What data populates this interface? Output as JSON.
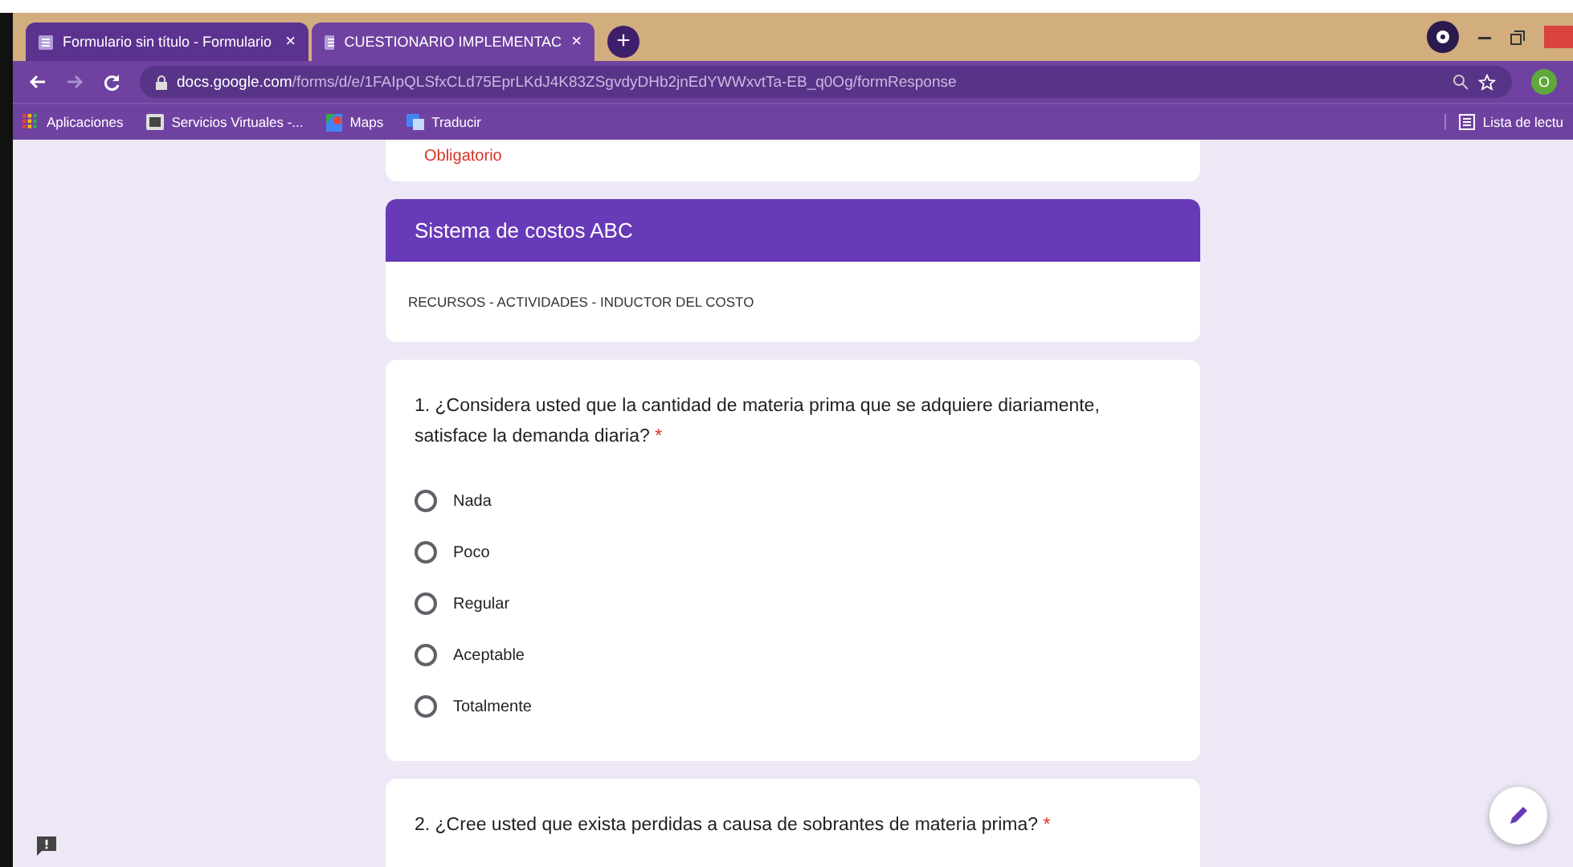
{
  "tabs": [
    {
      "label": "Formulario sin título - Formulario",
      "selected": false,
      "close": "×"
    },
    {
      "label": "CUESTIONARIO IMPLEMENTAC",
      "selected": true,
      "close": "×"
    }
  ],
  "new_tab": "+",
  "address_bar": {
    "domain": "docs.google.com",
    "path": "/forms/d/e/1FAIpQLSfxCLd75EprLKdJ4K83ZSgvdyDHb2jnEdYWWxvtTa-EB_q0Og/formResponse"
  },
  "profile_initial": "O",
  "bookmarks": [
    {
      "label": "Aplicaciones",
      "kind": "apps"
    },
    {
      "label": "Servicios Virtuales -...",
      "kind": "page"
    },
    {
      "label": "Maps",
      "kind": "maps"
    },
    {
      "label": "Traducir",
      "kind": "translate"
    }
  ],
  "reading_list": "Lista de lectu",
  "previous_card": {
    "note": "Obligatorio"
  },
  "section": {
    "title": "Sistema de costos ABC",
    "description": "RECURSOS - ACTIVIDADES - INDUCTOR DEL COSTO"
  },
  "questions": [
    {
      "text": "1. ¿Considera usted que la cantidad de materia prima que se adquiere diariamente, satisface la demanda diaria?",
      "required_mark": "*",
      "options": [
        {
          "label": "Nada",
          "selected": false
        },
        {
          "label": "Poco",
          "selected": false
        },
        {
          "label": "Regular",
          "selected": false
        },
        {
          "label": "Aceptable",
          "selected": false
        },
        {
          "label": "Totalmente",
          "selected": false
        }
      ]
    },
    {
      "text": "2. ¿Cree usted que exista perdidas a causa de sobrantes de materia prima?",
      "required_mark": "*"
    }
  ]
}
